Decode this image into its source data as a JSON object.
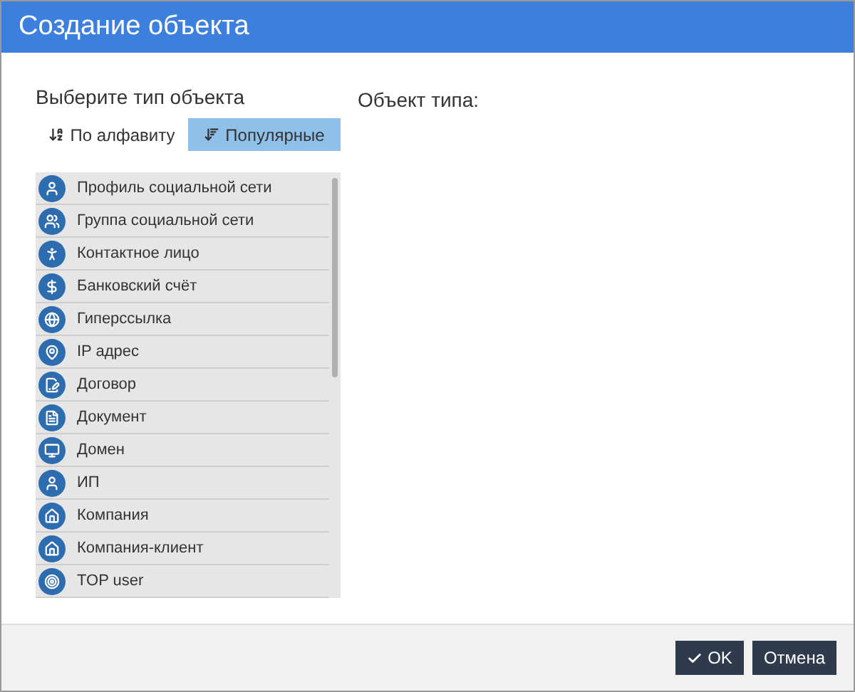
{
  "window": {
    "title": "Создание объекта"
  },
  "left": {
    "heading": "Выберите тип объекта"
  },
  "sort_tabs": [
    {
      "label": "По алфавиту",
      "kind": "alpha",
      "selected": false
    },
    {
      "label": "Популярные",
      "kind": "popular",
      "selected": true
    }
  ],
  "object_types": [
    {
      "label": "Профиль социальной сети",
      "kind": "user"
    },
    {
      "label": "Группа социальной сети",
      "kind": "group"
    },
    {
      "label": "Контактное лицо",
      "kind": "person"
    },
    {
      "label": "Банковский счёт",
      "kind": "money"
    },
    {
      "label": "Гиперссылка",
      "kind": "globe"
    },
    {
      "label": "IP адрес",
      "kind": "pin"
    },
    {
      "label": "Договор",
      "kind": "contract"
    },
    {
      "label": "Документ",
      "kind": "doc"
    },
    {
      "label": "Домен",
      "kind": "domain"
    },
    {
      "label": "ИП",
      "kind": "user"
    },
    {
      "label": "Компания",
      "kind": "house"
    },
    {
      "label": "Компания-клиент",
      "kind": "home"
    },
    {
      "label": "TOP user",
      "kind": "target"
    }
  ],
  "right": {
    "heading": "Объект типа:"
  },
  "buttons": [
    {
      "label": "OK",
      "kind": "ok"
    },
    {
      "label": "Отмена",
      "kind": "cancel"
    }
  ]
}
